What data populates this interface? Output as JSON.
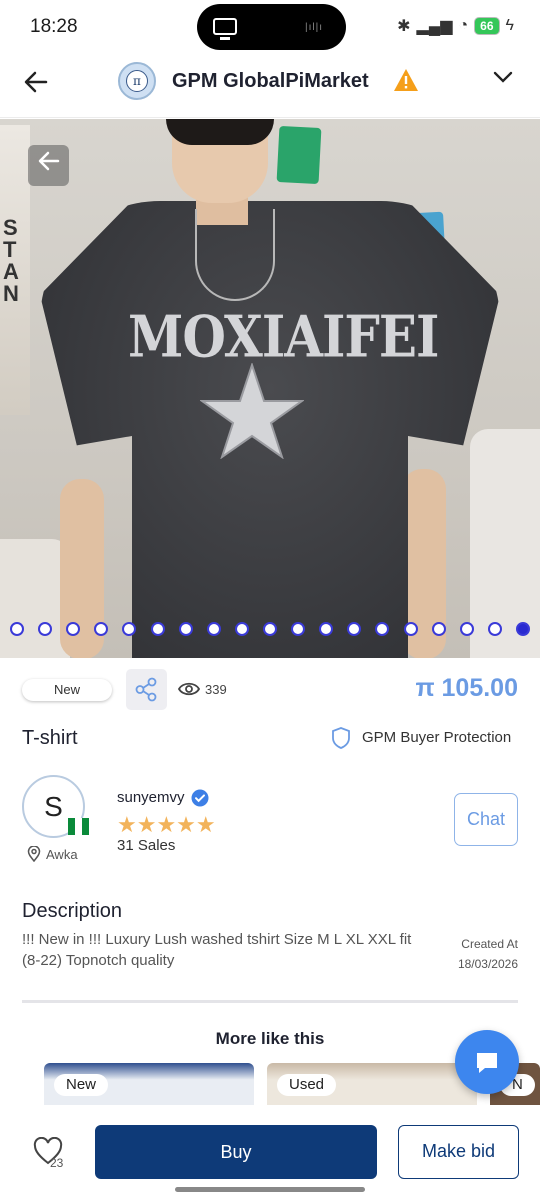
{
  "status_bar": {
    "time": "18:28",
    "battery": "66"
  },
  "header": {
    "title": "GPM GlobalPiMarket",
    "logo_text": "π"
  },
  "gallery": {
    "image_count": 19,
    "active_index": 18,
    "brand_print": "MOXIAIFEI"
  },
  "product": {
    "condition": "New",
    "views": "339",
    "price": "π 105.00",
    "title": "T-shirt",
    "protection_label": "GPM Buyer Protection"
  },
  "seller": {
    "initial": "S",
    "name": "sunyemvy",
    "rating": 4.5,
    "stars": "★★★★★",
    "sales": "31 Sales",
    "location": "Awka",
    "chat_label": "Chat"
  },
  "description": {
    "heading": "Description",
    "text": "!!! New in !!! Luxury Lush washed tshirt Size M L XL XXL fit (8-22) Topnotch quality",
    "created_label": "Created At",
    "created_date": "18/03/2026"
  },
  "more_like_this": {
    "heading": "More like this",
    "cards": [
      {
        "badge": "New"
      },
      {
        "badge": "Used"
      },
      {
        "badge": "N"
      }
    ]
  },
  "bottom_bar": {
    "likes": "23",
    "buy_label": "Buy",
    "bid_label": "Make bid"
  },
  "colors": {
    "primary": "#0e3a78",
    "price": "#6b9be3",
    "star": "#f2b35b",
    "fab": "#3d86ee",
    "dot": "#2a2ad0"
  }
}
